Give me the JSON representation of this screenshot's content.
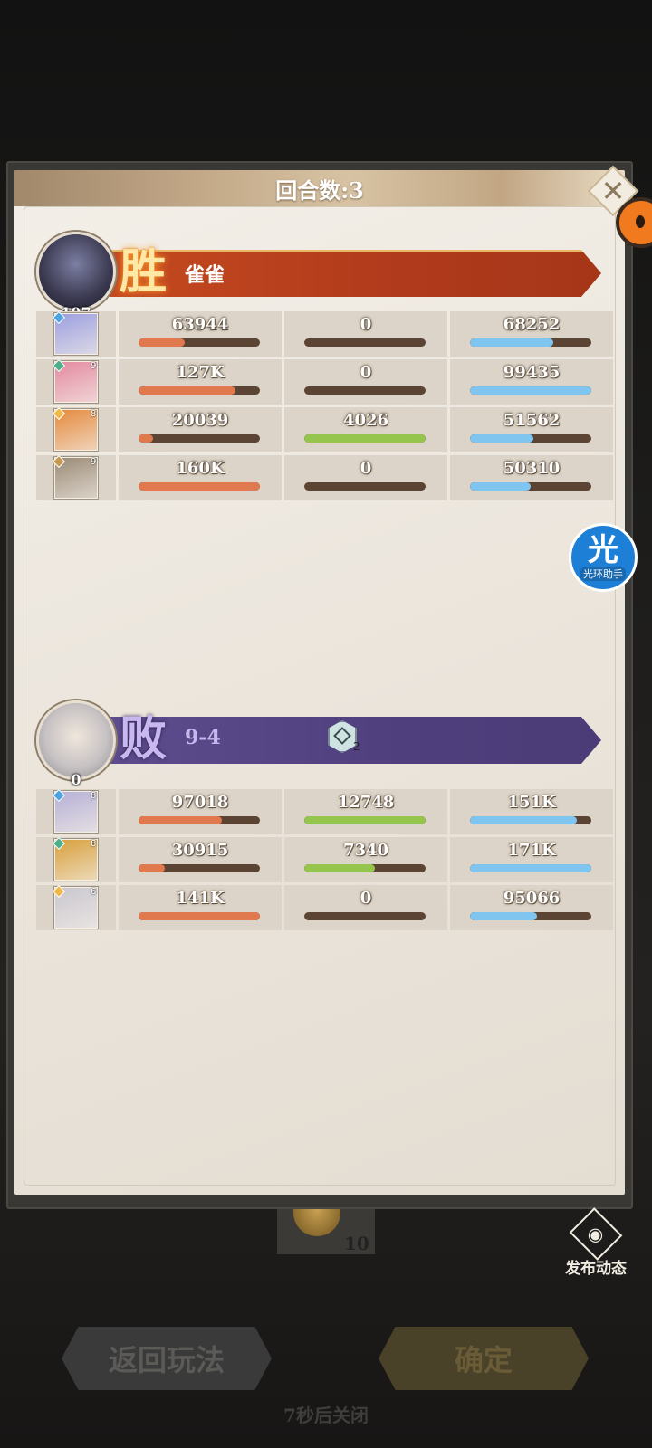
{
  "dialog": {
    "title": "回合数:3"
  },
  "win_team": {
    "result": "胜",
    "name": "雀雀",
    "leader_level": "197",
    "rows": [
      {
        "level": "",
        "gem_color": "#4fa3e0",
        "portrait": "#9c9fe0",
        "damage": "63944",
        "damage_pct": 0.38,
        "heal": "0",
        "heal_pct": 0,
        "taken": "68252",
        "taken_pct": 0.69
      },
      {
        "level": "9",
        "gem_color": "#4caf8a",
        "portrait": "#e48aa0",
        "damage": "127K",
        "damage_pct": 0.8,
        "heal": "0",
        "heal_pct": 0,
        "taken": "99435",
        "taken_pct": 1.0
      },
      {
        "level": "8",
        "gem_color": "#f0b84a",
        "portrait": "#e58a3d",
        "damage": "20039",
        "damage_pct": 0.12,
        "heal": "4026",
        "heal_pct": 1.0,
        "taken": "51562",
        "taken_pct": 0.52
      },
      {
        "level": "9",
        "gem_color": "#c79a52",
        "portrait": "#9b8b77",
        "damage": "160K",
        "damage_pct": 1.0,
        "heal": "0",
        "heal_pct": 0,
        "taken": "50310",
        "taken_pct": 0.5
      }
    ]
  },
  "lose_team": {
    "result": "败",
    "name": "9-4",
    "leader_level": "0",
    "badge_count": "2",
    "rows": [
      {
        "level": "8",
        "gem_color": "#4fa3e0",
        "portrait": "#b7b0d6",
        "damage": "97018",
        "damage_pct": 0.69,
        "heal": "12748",
        "heal_pct": 1.0,
        "taken": "151K",
        "taken_pct": 0.88
      },
      {
        "level": "8",
        "gem_color": "#4caf8a",
        "portrait": "#d8a03c",
        "damage": "30915",
        "damage_pct": 0.22,
        "heal": "7340",
        "heal_pct": 0.58,
        "taken": "171K",
        "taken_pct": 1.0
      },
      {
        "level": "6",
        "gem_color": "#f0b84a",
        "portrait": "#c9c6cf",
        "damage": "141K",
        "damage_pct": 1.0,
        "heal": "0",
        "heal_pct": 0,
        "taken": "95066",
        "taken_pct": 0.55
      }
    ]
  },
  "colors": {
    "damage_bar": "#e07a4e",
    "heal_bar": "#95c54c",
    "taken_bar": "#7fc5ef",
    "win_banner": "#b03a1c",
    "lose_banner": "#4f3f7d"
  },
  "side_helper": {
    "icon": "光",
    "label": "光环助手"
  },
  "reward": {
    "count": "10"
  },
  "post": {
    "icon": "camera-icon",
    "label": "发布动态"
  },
  "buttons": {
    "back": "返回玩法",
    "confirm": "确定"
  },
  "countdown": "7秒后关闭"
}
